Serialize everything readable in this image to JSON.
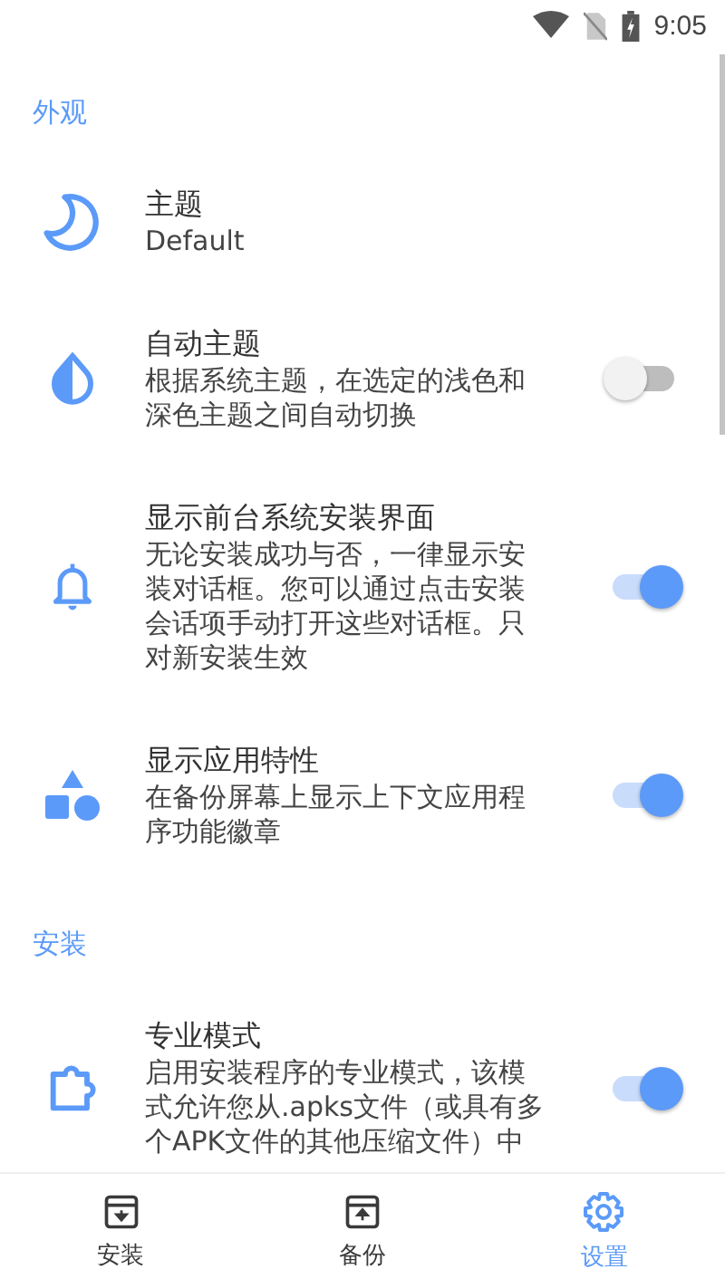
{
  "status_bar": {
    "time": "9:05"
  },
  "sections": [
    {
      "title": "外观",
      "items": [
        {
          "title": "主题",
          "subtitle": "Default"
        },
        {
          "title": "自动主题",
          "subtitle": "根据系统主题，在选定的浅色和深色主题之间自动切换",
          "on": false
        },
        {
          "title": "显示前台系统安装界面",
          "subtitle": "无论安装成功与否，一律显示安装对话框。您可以通过点击安装会话项手动打开这些对话框。只对新安装生效",
          "on": true
        },
        {
          "title": "显示应用特性",
          "subtitle": "在备份屏幕上显示上下文应用程序功能徽章",
          "on": true
        }
      ]
    },
    {
      "title": "安装",
      "items": [
        {
          "title": "专业模式",
          "subtitle": "启用安装程序的专业模式，该模式允许您从.apks文件（或具有多个APK文件的其他压缩文件）中",
          "on": true
        }
      ]
    }
  ],
  "nav": [
    {
      "label": "安装",
      "selected": false
    },
    {
      "label": "备份",
      "selected": false
    },
    {
      "label": "设置",
      "selected": true
    }
  ]
}
